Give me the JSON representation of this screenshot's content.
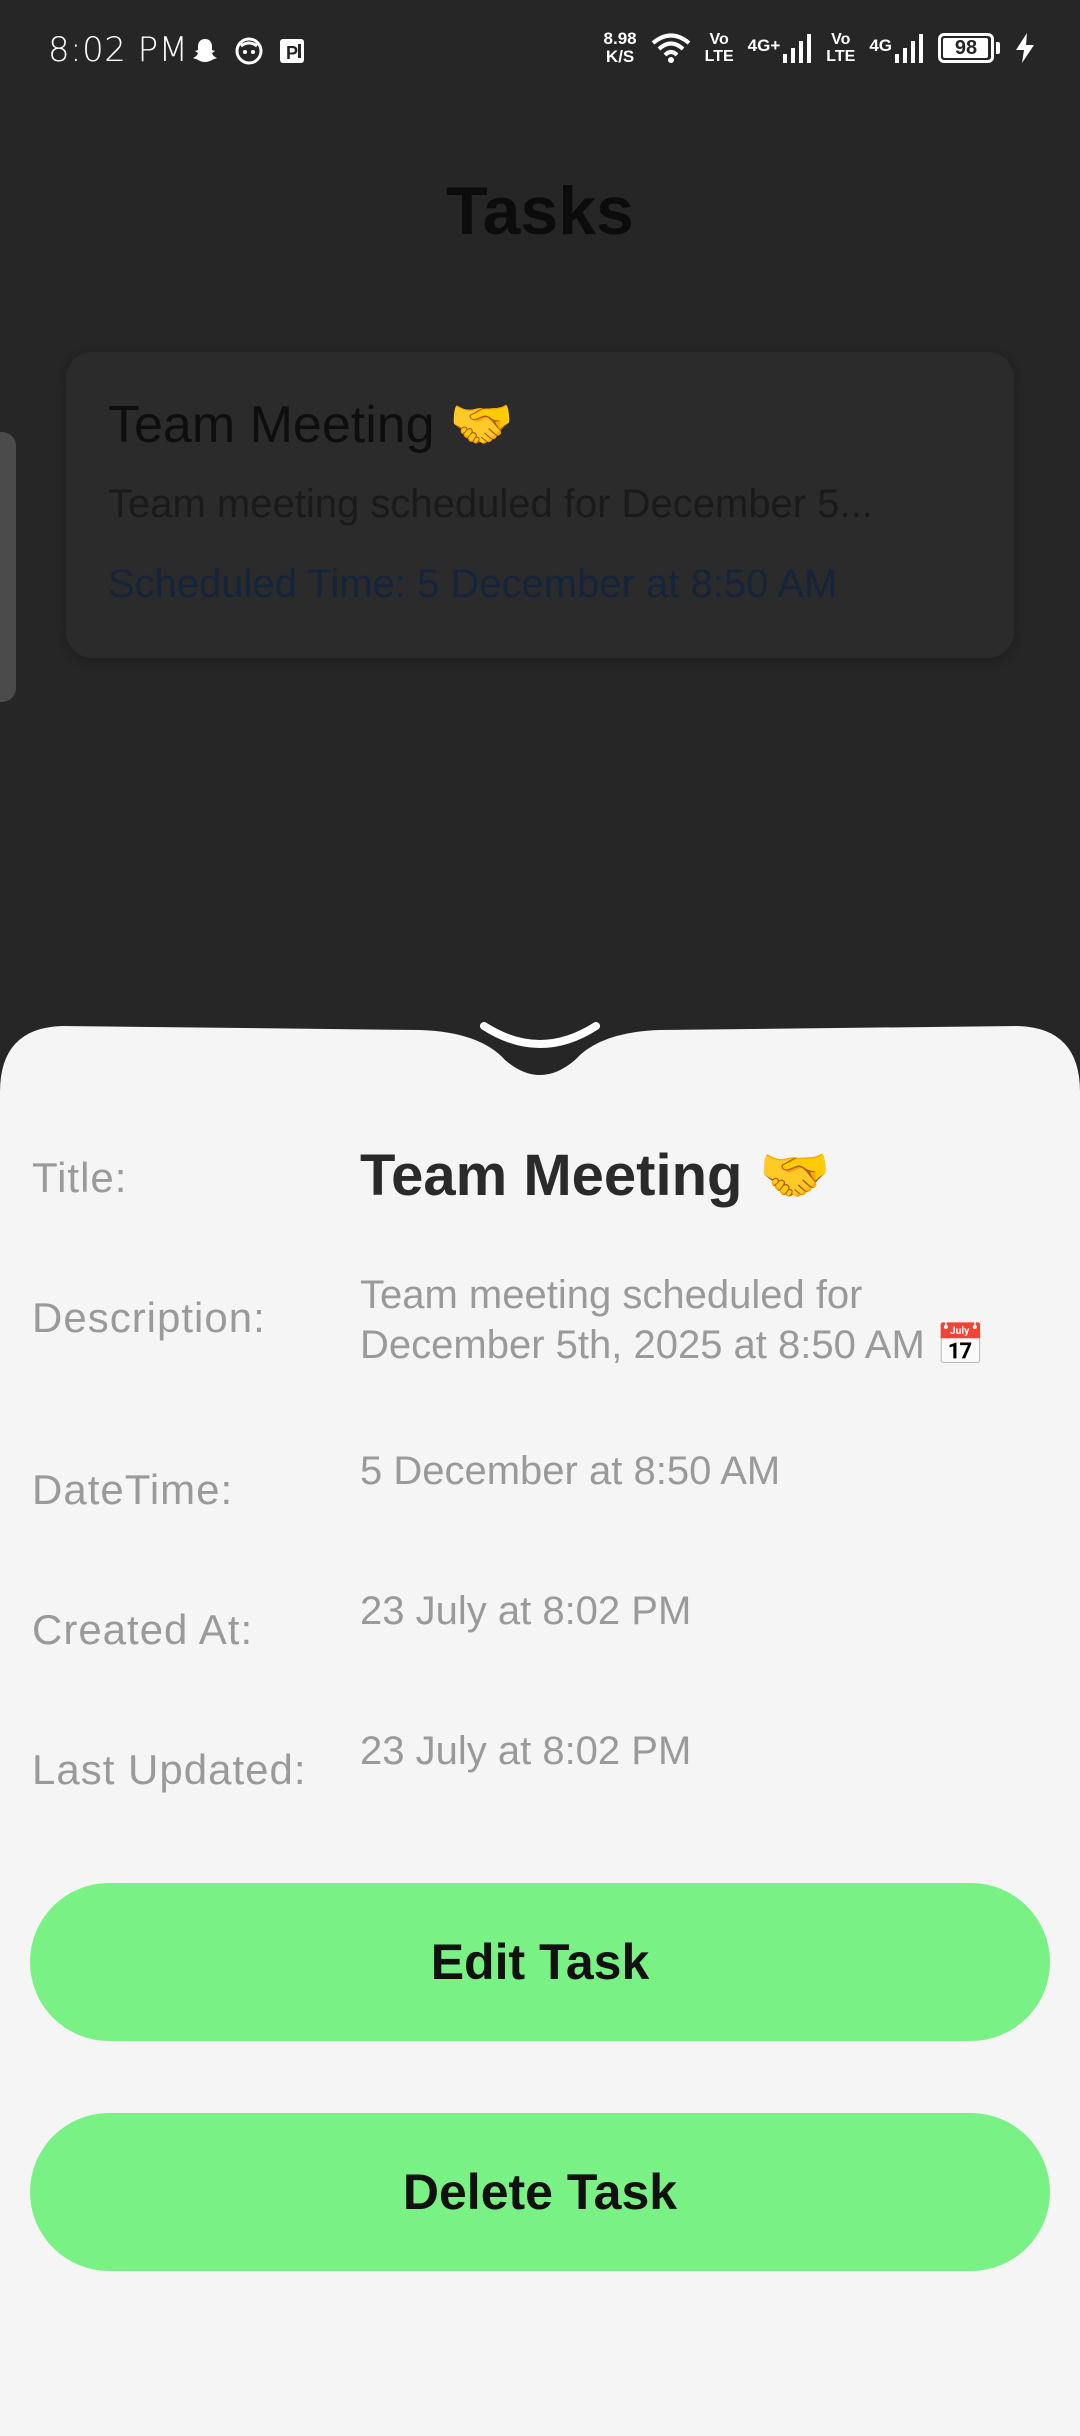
{
  "status_bar": {
    "time": "8:02 PM",
    "net_speed_value": "8.98",
    "net_speed_unit": "K/S",
    "volte_1_top": "Vo",
    "volte_1_bottom": "LTE",
    "network_1": "4G+",
    "volte_2_top": "Vo",
    "volte_2_bottom": "LTE",
    "network_2": "4G",
    "battery_level": "98",
    "icons": [
      "snapchat-icon",
      "face-icon",
      "parking-app-icon",
      "wifi-icon",
      "signal-icon",
      "signal-icon",
      "battery-icon",
      "charging-bolt-icon"
    ]
  },
  "background": {
    "page_title": "Tasks",
    "task_card": {
      "title": "Team Meeting 🤝",
      "description": "Team meeting scheduled for December 5...",
      "scheduled_time": "Scheduled Time: 5 December at 8:50 AM"
    }
  },
  "sheet": {
    "rows": [
      {
        "label": "Title:",
        "value": "Team Meeting 🤝"
      },
      {
        "label": "Description:",
        "value": "Team meeting scheduled for December 5th, 2025 at 8:50 AM 📅"
      },
      {
        "label": "DateTime:",
        "value": "5 December at 8:50 AM"
      },
      {
        "label": "Created At:",
        "value": "23 July at 8:02 PM"
      },
      {
        "label": "Last Updated:",
        "value": "23 July at 8:02 PM"
      }
    ],
    "edit_button": "Edit Task",
    "delete_button": "Delete Task"
  },
  "colors": {
    "background_dim": "#262626",
    "sheet_bg": "#f5f5f5",
    "button_bg": "#79f185",
    "label": "#9a9a9a",
    "title_text": "#2a2a2a"
  }
}
